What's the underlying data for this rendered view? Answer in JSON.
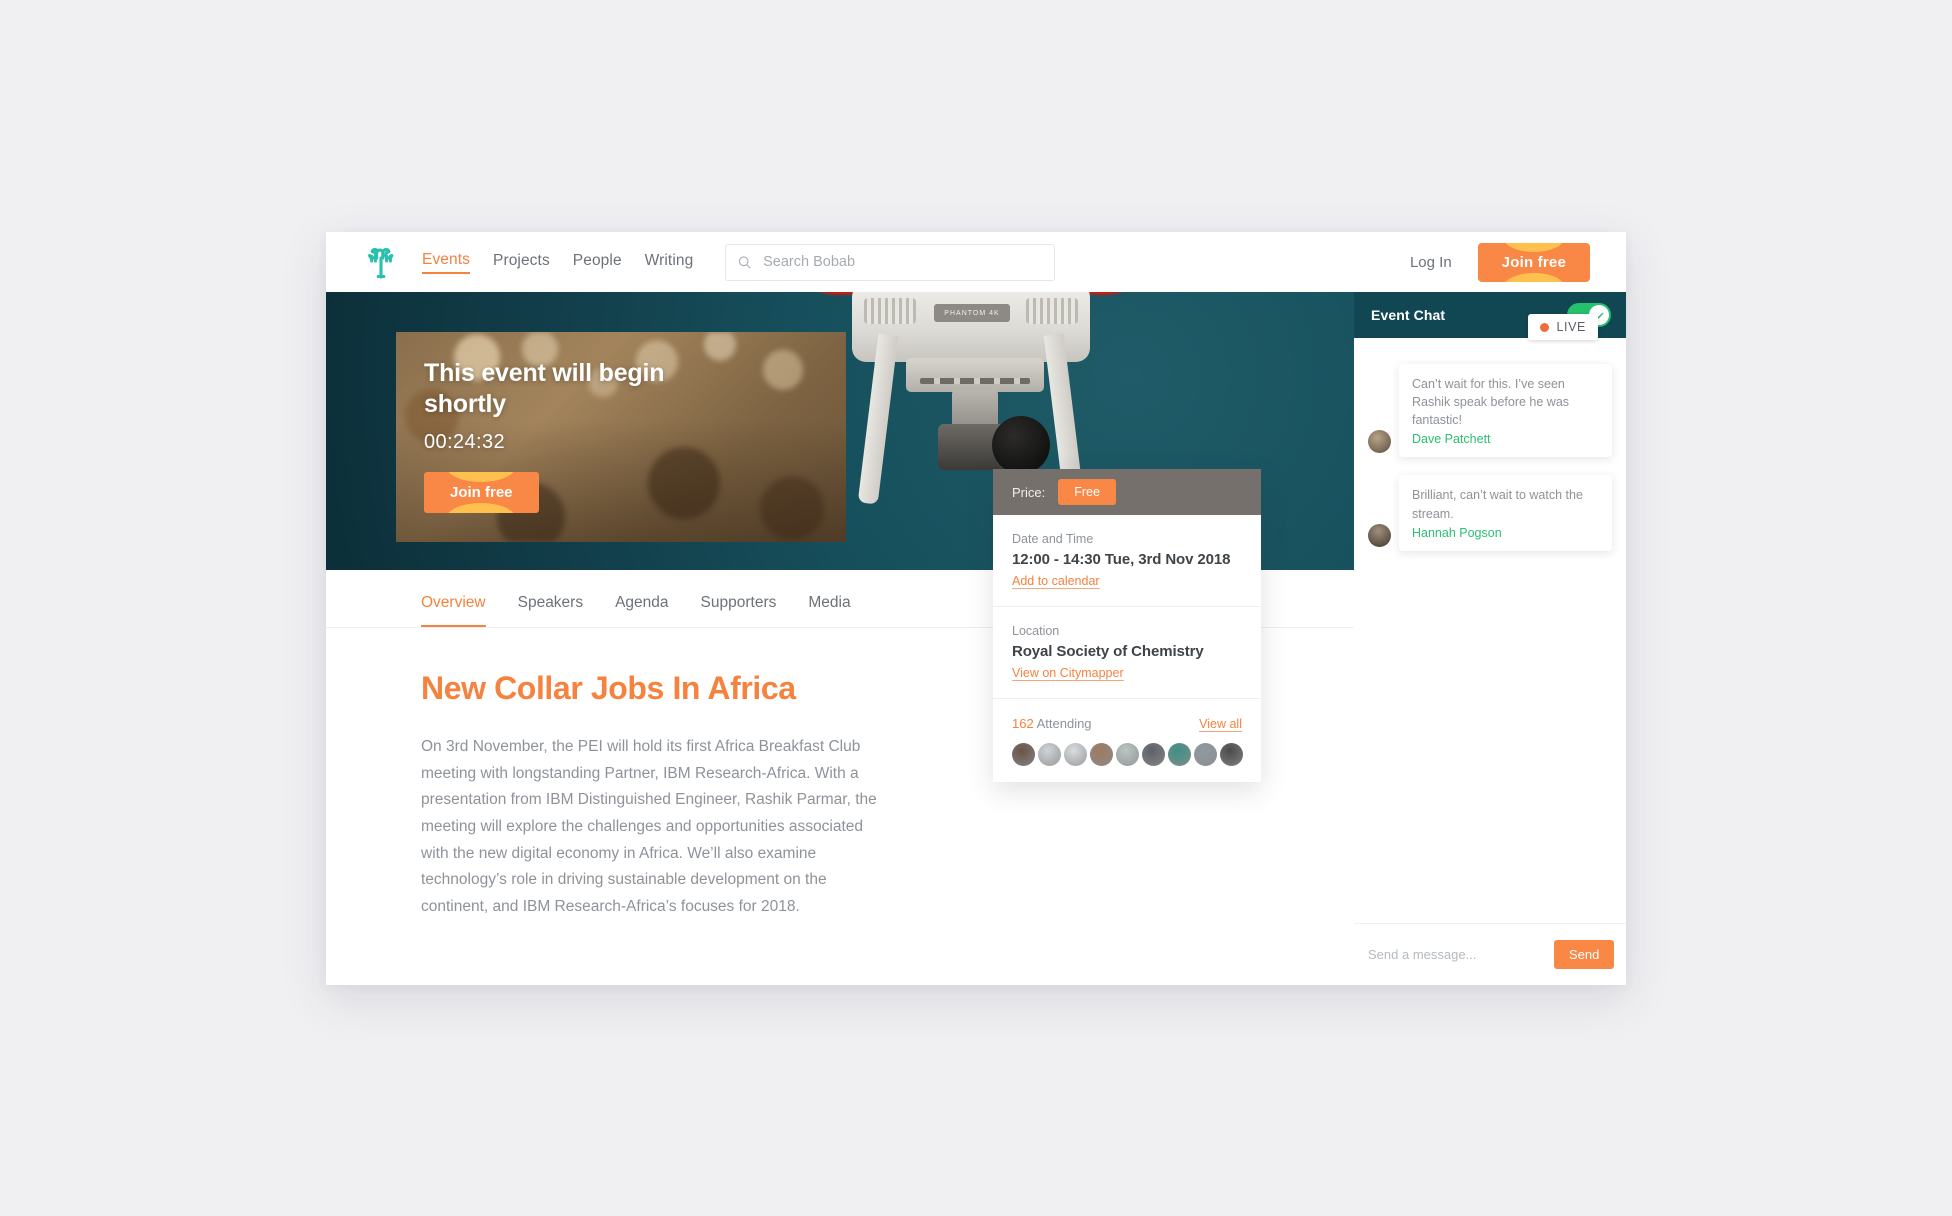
{
  "brand": {
    "logo_icon": "baobab-tree-logo",
    "accent": "#f5823f",
    "teal": "#2bbfae",
    "dark_teal": "#114753"
  },
  "header": {
    "nav": [
      {
        "label": "Events",
        "active": true
      },
      {
        "label": "Projects",
        "active": false
      },
      {
        "label": "People",
        "active": false
      },
      {
        "label": "Writing",
        "active": false
      }
    ],
    "search": {
      "placeholder": "Search Bobab",
      "value": "",
      "icon": "search-icon"
    },
    "login_label": "Log In",
    "join_label": "Join free"
  },
  "hero": {
    "live_label": "LIVE",
    "overlay_title": "This event will begin shortly",
    "countdown": "00:24:32",
    "join_label": "Join free",
    "drone_badge": "PHANTOM 4K"
  },
  "event_card": {
    "price_label": "Price:",
    "price_value": "Free",
    "datetime_label": "Date and Time",
    "datetime_value": "12:00 - 14:30 Tue, 3rd Nov 2018",
    "calendar_link": "Add to calendar",
    "location_label": "Location",
    "location_value": "Royal Society of Chemistry",
    "map_link": "View on Citymapper",
    "attending_count": "162",
    "attending_label": "Attending",
    "view_all_label": "View all",
    "avatars": [
      "#6a5348",
      "#cfd4d8",
      "#d9dde0",
      "#9c7b62",
      "#b9c6c4",
      "#5d6168",
      "#3f8f86",
      "#8f9aa3",
      "#4a4a4a"
    ]
  },
  "tabs": [
    {
      "label": "Overview",
      "active": true
    },
    {
      "label": "Speakers",
      "active": false
    },
    {
      "label": "Agenda",
      "active": false
    },
    {
      "label": "Supporters",
      "active": false
    },
    {
      "label": "Media",
      "active": false
    }
  ],
  "article": {
    "title": "New Collar Jobs In Africa",
    "body": "On 3rd November, the PEI will hold its first Africa Breakfast Club meeting with longstanding Partner, IBM Research-Africa. With a presentation from IBM Distinguished Engineer, Rashik Parmar, the meeting will explore the challenges and opportunities associated with the new digital economy in Africa. We’ll also examine technology’s role in driving sustainable development on the continent, and IBM Research-Africa’s focuses for 2018."
  },
  "chat": {
    "title": "Event Chat",
    "toggle_on": true,
    "messages": [
      {
        "text": "Can’t wait for this. I’ve seen Rashik speak before he was fantastic!",
        "name": "Dave Patchett",
        "avatar": "#7a6a55"
      },
      {
        "text": "Brilliant,  can’t wait to watch the stream.",
        "name": "Hannah Pogson",
        "avatar": "#5c5148"
      }
    ],
    "input_placeholder": "Send a message...",
    "input_value": "",
    "send_label": "Send"
  }
}
